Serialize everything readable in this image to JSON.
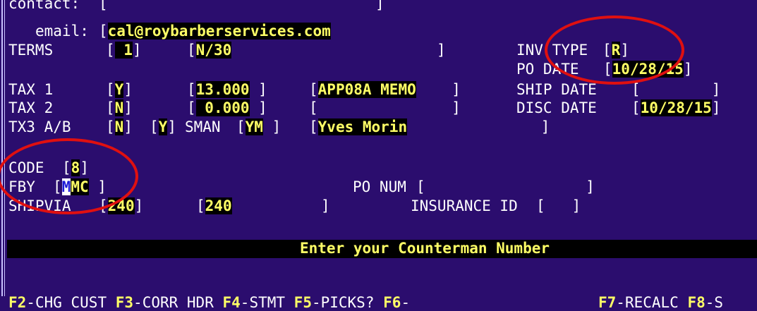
{
  "form": {
    "contact_label": "contact:",
    "contact_value": "",
    "email_label": "email:",
    "email_value": "cal@roybarberservices.com",
    "terms_label": "TERMS",
    "terms_code": " 1",
    "terms_desc": "N/30",
    "inv_type_label": "INV TYPE",
    "inv_type_value": "R",
    "po_date_label": "PO DATE",
    "po_date_value": "10/28/15",
    "tax1_label": "TAX 1",
    "tax1_flag": "Y",
    "tax1_rate": "13.000",
    "tax1_desc": "APP08A MEMO",
    "ship_date_label": "SHIP DATE",
    "ship_date_value": "",
    "tax2_label": "TAX 2",
    "tax2_flag": "N",
    "tax2_rate": " 0.000",
    "tax2_desc": "",
    "disc_date_label": "DISC DATE",
    "disc_date_value": "10/28/15",
    "tx3_label": "TX3 A/B",
    "tx3_a": "N",
    "tx3_b": "Y",
    "sman_label": "SMAN",
    "sman_code": "YM",
    "sman_name": "Yves Morin",
    "code_label": "CODE",
    "code_value": "8",
    "fby_label": "FBY",
    "fby_cursor": "M",
    "fby_rest": "MC",
    "po_num_label": "PO NUM",
    "po_num_value": "",
    "shipvia_label": "SHIPVIA",
    "shipvia_code": "240",
    "shipvia_desc": "240",
    "insurance_label": "INSURANCE ID",
    "insurance_value": ""
  },
  "prompt": "Enter your Counterman Number",
  "function_keys": [
    {
      "key": "F2",
      "label": "-CHG CUST"
    },
    {
      "key": "F3",
      "label": "-CORR HDR"
    },
    {
      "key": "F4",
      "label": "-STMT"
    },
    {
      "key": "F5",
      "label": "-PICKS?"
    },
    {
      "key": "F6",
      "label": "-"
    },
    {
      "key": "F7",
      "label": "-RECALC"
    },
    {
      "key": "F8",
      "label": "-S"
    }
  ],
  "colors": {
    "background": "#2b0d6e",
    "field_background": "#000000",
    "field_text": "#ffff66",
    "annotation_circle": "#e01010"
  }
}
